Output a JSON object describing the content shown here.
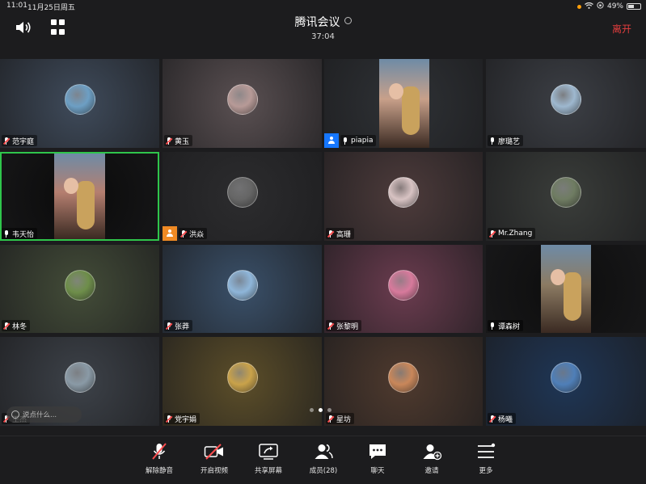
{
  "status": {
    "time": "11:01",
    "date": "11月25日周五",
    "battery": "49%"
  },
  "header": {
    "title": "腾讯会议",
    "timer": "37:04",
    "leave_label": "离开"
  },
  "participants": [
    {
      "name": "范宇庭",
      "bg": "#3f4b5b",
      "av": "#6d9fc4"
    },
    {
      "name": "黄玉",
      "bg": "#5a5052",
      "av": "#b79a97"
    },
    {
      "name": "piapia",
      "bg": "#2f3236",
      "av": "#c8a08a"
    },
    {
      "name": "廖璐艺",
      "bg": "#3c3f45",
      "av": "#9eb8cf"
    },
    {
      "name": "韦天怡",
      "bg": "#0a0a0a",
      "av": "#b57f70"
    },
    {
      "name": "洪焱",
      "bg": "#2c2c2e",
      "av": "#666"
    },
    {
      "name": "高珊",
      "bg": "#4d3b3b",
      "av": "#d8c3c3"
    },
    {
      "name": "Mr.Zhang",
      "bg": "#3a3d3a",
      "av": "#6f7c62"
    },
    {
      "name": "林冬",
      "bg": "#434c38",
      "av": "#6e8e4a"
    },
    {
      "name": "张莽",
      "bg": "#3a5069",
      "av": "#8fb6d9"
    },
    {
      "name": "张黎明",
      "bg": "#6b3c4f",
      "av": "#d77a9c"
    },
    {
      "name": "谭森树",
      "bg": "#0d0d0d",
      "av": "#8c7b63"
    },
    {
      "name": "王杰",
      "bg": "#3d4249",
      "av": "#8a9aa6"
    },
    {
      "name": "党宇娟",
      "bg": "#5c4e29",
      "av": "#c9a24a"
    },
    {
      "name": "星坊",
      "bg": "#4f3a2e",
      "av": "#c9875a"
    },
    {
      "name": "杨曦",
      "bg": "#1f3656",
      "av": "#4f7fb8"
    }
  ],
  "chat": {
    "placeholder": "说点什么..."
  },
  "toolbar": {
    "unmute": "解除静音",
    "video": "开启视频",
    "share": "共享屏幕",
    "members": "成员(28)",
    "chat": "聊天",
    "invite": "邀请",
    "more": "更多"
  }
}
